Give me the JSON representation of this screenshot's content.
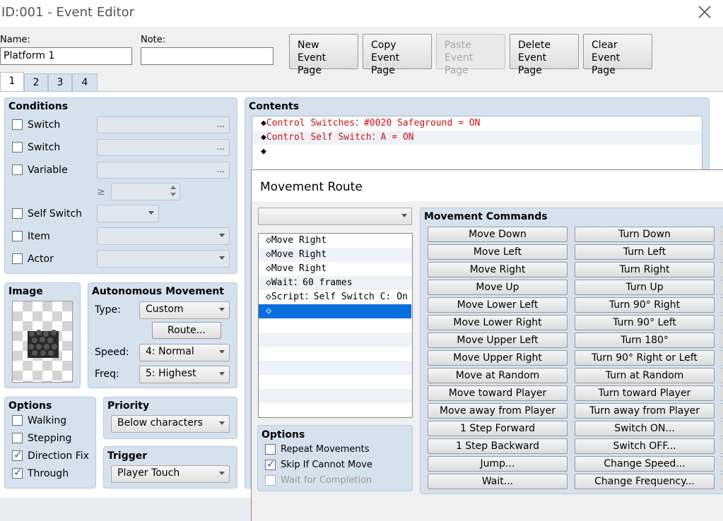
{
  "window": {
    "title": "ID:001 - Event Editor",
    "close_icon": "close-icon"
  },
  "header": {
    "name_label": "Name:",
    "name_value": "Platform 1",
    "note_label": "Note:",
    "note_value": "",
    "buttons": [
      {
        "l1": "New",
        "l2": "Event Page",
        "enabled": true
      },
      {
        "l1": "Copy",
        "l2": "Event Page",
        "enabled": true
      },
      {
        "l1": "Paste",
        "l2": "Event Page",
        "enabled": false
      },
      {
        "l1": "Delete",
        "l2": "Event Page",
        "enabled": true
      },
      {
        "l1": "Clear",
        "l2": "Event Page",
        "enabled": true
      }
    ]
  },
  "tabs": [
    "1",
    "2",
    "3",
    "4"
  ],
  "conditions": {
    "title": "Conditions",
    "switch1": "Switch",
    "switch2": "Switch",
    "variable": "Variable",
    "geq": "≥",
    "self_switch": "Self Switch",
    "item": "Item",
    "actor": "Actor",
    "dots": "..."
  },
  "image": {
    "title": "Image"
  },
  "autonomous": {
    "title": "Autonomous Movement",
    "type_label": "Type:",
    "type_value": "Custom",
    "route_button": "Route...",
    "speed_label": "Speed:",
    "speed_value": "4: Normal",
    "freq_label": "Freq:",
    "freq_value": "5: Highest"
  },
  "options": {
    "title": "Options",
    "walking": "Walking",
    "stepping": "Stepping",
    "direction_fix": "Direction Fix",
    "through": "Through"
  },
  "priority": {
    "title": "Priority",
    "value": "Below characters"
  },
  "trigger": {
    "title": "Trigger",
    "value": "Player Touch"
  },
  "contents": {
    "title": "Contents",
    "lines": [
      {
        "marker": "◆",
        "text": "Control Switches：#0020 Safeground = ON"
      },
      {
        "marker": "◆",
        "text": "Control Self Switch：A = ON"
      },
      {
        "marker": "◆",
        "text": ""
      }
    ]
  },
  "movement_route": {
    "title": "Movement Route",
    "target": "",
    "list": [
      {
        "marker": "◇",
        "text": "Move Right"
      },
      {
        "marker": "◇",
        "text": "Move Right"
      },
      {
        "marker": "◇",
        "text": "Move Right"
      },
      {
        "marker": "◇",
        "text": "Wait：60 frames"
      },
      {
        "marker": "◇",
        "text": "Script：Self Switch C: On"
      },
      {
        "marker": "◇",
        "text": ""
      }
    ],
    "options": {
      "title": "Options",
      "repeat": "Repeat Movements",
      "skip": "Skip If Cannot Move",
      "wait": "Wait for Completion"
    },
    "commands_title": "Movement Commands",
    "commands_left": [
      "Move Down",
      "Move Left",
      "Move Right",
      "Move Up",
      "Move Lower Left",
      "Move Lower Right",
      "Move Upper Left",
      "Move Upper Right",
      "Move at Random",
      "Move toward Player",
      "Move away from Player",
      "1 Step Forward",
      "1 Step Backward",
      "Jump...",
      "Wait..."
    ],
    "commands_right": [
      "Turn Down",
      "Turn Left",
      "Turn Right",
      "Turn Up",
      "Turn 90° Right",
      "Turn 90° Left",
      "Turn 180°",
      "Turn 90° Right or Left",
      "Turn at Random",
      "Turn toward Player",
      "Turn away from Player",
      "Switch ON...",
      "Switch OFF...",
      "Change Speed...",
      "Change Frequency..."
    ]
  },
  "colors": {
    "command_red": "#d01010",
    "selection": "#0a6fdc",
    "panel": "#d6e1ee"
  }
}
